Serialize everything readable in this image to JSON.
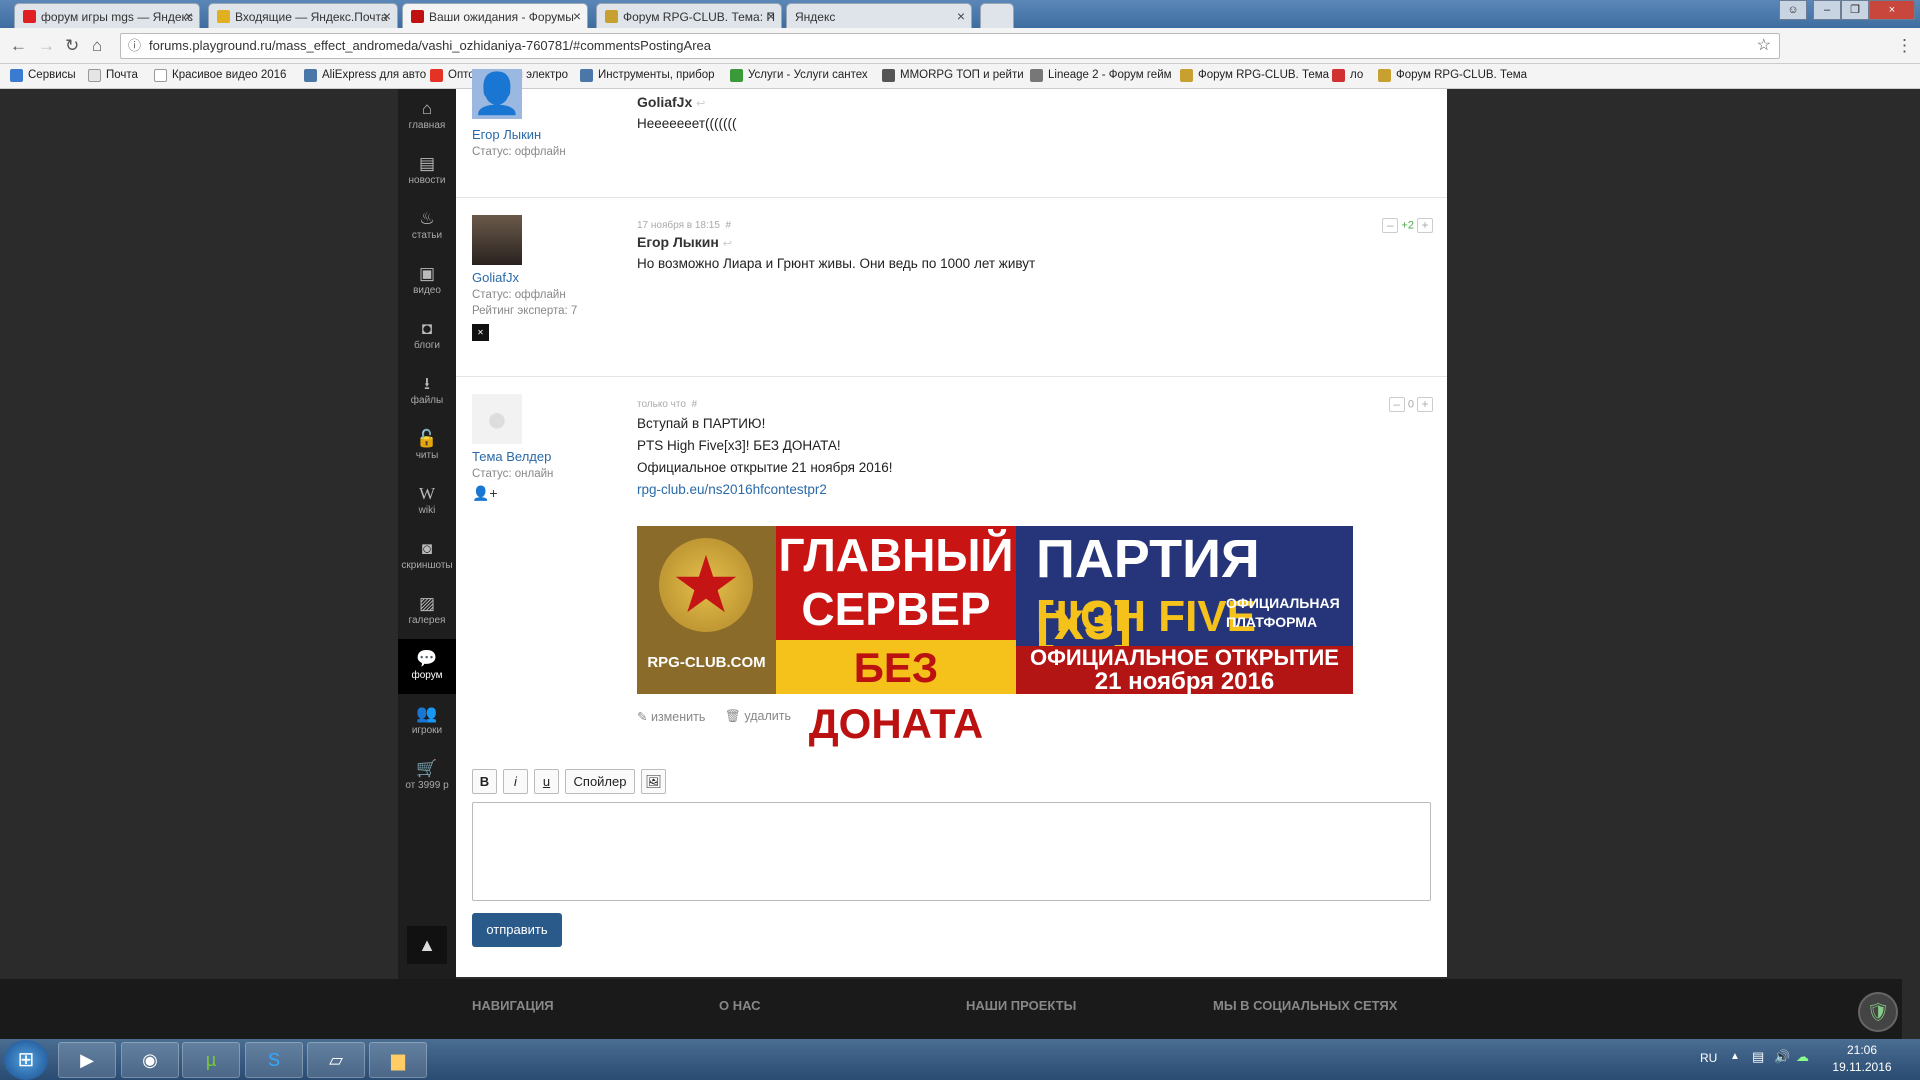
{
  "browser": {
    "tabs": [
      {
        "label": "форум игры mgs — Яндекс",
        "favicon_color": "#e02020"
      },
      {
        "label": "Входящие — Яндекс.Почта",
        "favicon_color": "#e0b020"
      },
      {
        "label": "Ваши ожидания - Форумы",
        "favicon_color": "#c01010"
      },
      {
        "label": "Форум RPG-CLUB. Тема: П",
        "favicon_color": "#c8a030"
      },
      {
        "label": "Яндекс",
        "favicon_color": ""
      }
    ],
    "url": "forums.playground.ru/mass_effect_andromeda/vashi_ozhidaniya-760781/#commentsPostingArea",
    "bookmarks": [
      "Сервисы",
      "Почта",
      "Красивое видео 2016",
      "AliExpress для авто",
      "Оптовая весы электро",
      "Инструменты, прибор",
      "Услуги - Услуги сантех",
      "MMORPG ТОП и рейти",
      "Lineage 2 - Форум гейм",
      "Форум RPG-CLUB. Тема",
      "ло",
      "Форум RPG-CLUB. Тема"
    ]
  },
  "sidebar": {
    "items": [
      {
        "label": "главная",
        "icon": "⌂"
      },
      {
        "label": "новости",
        "icon": "▤"
      },
      {
        "label": "статьи",
        "icon": "♨"
      },
      {
        "label": "видео",
        "icon": "▣"
      },
      {
        "label": "блоги",
        "icon": "◘"
      },
      {
        "label": "файлы",
        "icon": "⭳"
      },
      {
        "label": "читы",
        "icon": "🔓"
      },
      {
        "label": "wiki",
        "icon": "W"
      },
      {
        "label": "скриншоты",
        "icon": "◙"
      },
      {
        "label": "галерея",
        "icon": "▨"
      },
      {
        "label": "форум",
        "icon": "💬"
      },
      {
        "label": "игроки",
        "icon": "👥"
      },
      {
        "label": "от 3999 р",
        "icon": "🛒"
      }
    ]
  },
  "posts": [
    {
      "author": "Егор Лыкин",
      "status": "Статус: оффлайн",
      "reply_to": "GoliafJx",
      "text": [
        "Нееееееет((((((("
      ]
    },
    {
      "author": "GoliafJx",
      "status": "Статус: оффлайн",
      "rating": "Рейтинг эксперта: 7",
      "date": "17 ноября в 18:15",
      "hash": "#",
      "reply_to": "Егор Лыкин",
      "text": [
        "Но возможно Лиара и Грюнт живы. Они ведь по 1000 лет живут"
      ],
      "score": "+2"
    },
    {
      "author": "Тема Велдер",
      "status": "Статус: онлайн",
      "date": "только что",
      "hash": "#",
      "text": [
        "Вступай в ПАРТИЮ!",
        "PTS High Five[x3]! БЕЗ ДОНАТА!",
        "Официальное открытие 21 ноября 2016!"
      ],
      "link": "rpg-club.eu/ns2016hfcontestpr2",
      "score": "0",
      "edit": "изменить",
      "delete": "удалить"
    }
  ],
  "banner": {
    "site": "RPG-CLUB.COM",
    "line1": "ГЛАВНЫЙ",
    "line2": "СЕРВЕР",
    "line3": "БЕЗ ДОНАТА",
    "party": "ПАРТИЯ",
    "rate": "[x3]",
    "hf": "HIGH FIVE",
    "official": "ОФИЦИАЛЬНАЯ",
    "platform": "ПЛАТФОРМА",
    "opening": "ОФИЦИАЛЬНОЕ ОТКРЫТИЕ",
    "date": "21 ноября 2016"
  },
  "editor": {
    "bold": "B",
    "italic": "i",
    "underline": "u",
    "spoiler": "Спойлер",
    "submit": "отправить"
  },
  "footer": [
    "НАВИГАЦИЯ",
    "О НАС",
    "НАШИ ПРОЕКТЫ",
    "МЫ В СОЦИАЛЬНЫХ СЕТЯХ"
  ],
  "taskbar": {
    "lang": "RU",
    "time": "21:06",
    "date": "19.11.2016"
  }
}
